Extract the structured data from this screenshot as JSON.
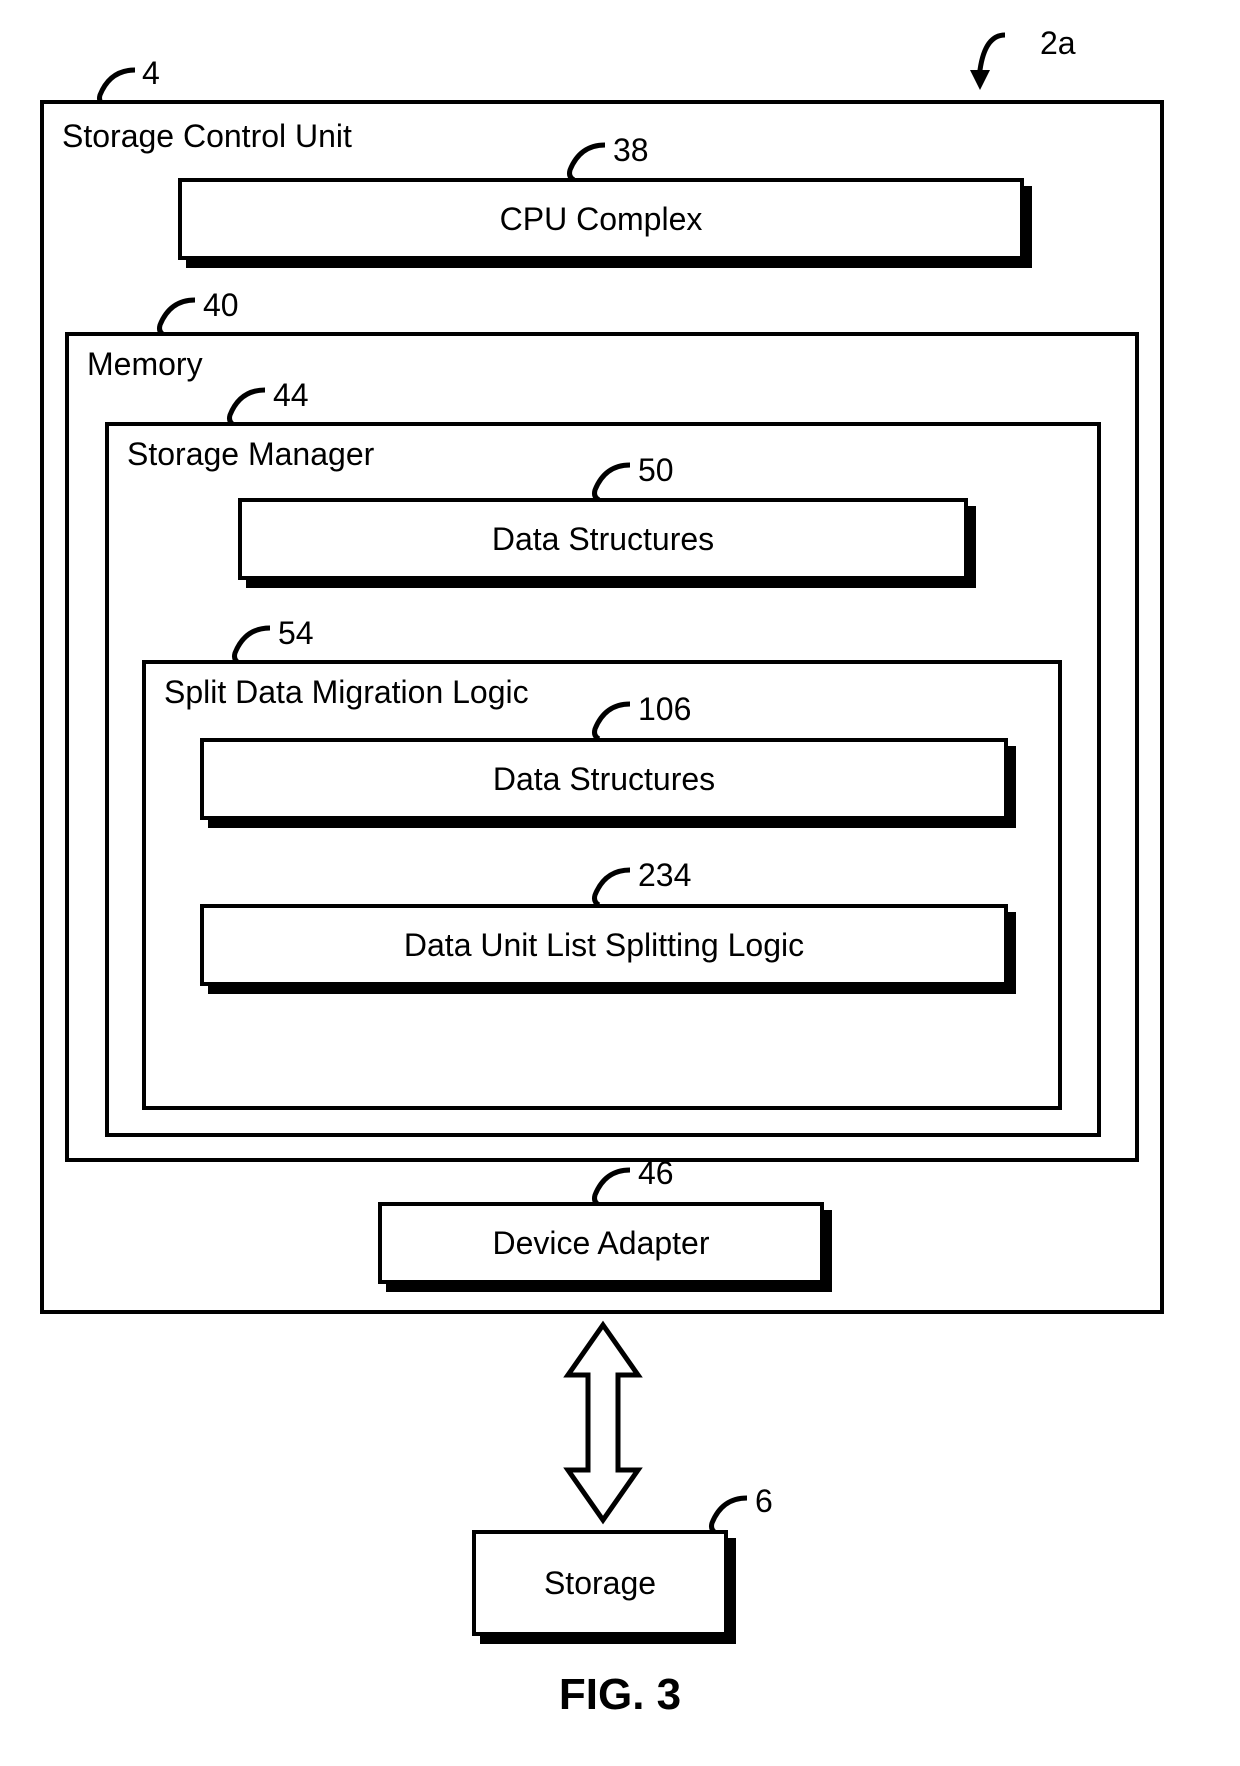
{
  "refs": {
    "fig2a": "2a",
    "storage_control_unit": "4",
    "storage": "6",
    "cpu_complex": "38",
    "memory": "40",
    "storage_manager": "44",
    "device_adapter": "46",
    "data_structures_1": "50",
    "split_data_migration_logic": "54",
    "data_structures_2": "106",
    "data_unit_list_splitting": "234"
  },
  "labels": {
    "storage_control_unit": "Storage Control Unit",
    "cpu_complex": "CPU Complex",
    "memory": "Memory",
    "storage_manager": "Storage Manager",
    "data_structures_1": "Data Structures",
    "split_data_migration_logic": "Split Data Migration Logic",
    "data_structures_2": "Data Structures",
    "data_unit_list_splitting": "Data Unit List Splitting Logic",
    "device_adapter": "Device Adapter",
    "storage": "Storage"
  },
  "caption": "FIG. 3"
}
